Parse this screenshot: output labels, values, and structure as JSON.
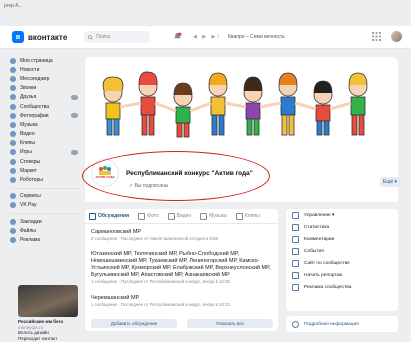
{
  "browser": {
    "tab_title": "prep A..."
  },
  "header": {
    "logo_text": "вконтакте",
    "search_placeholder": "Поиск",
    "player_controls": "◀ ▶ ▶|",
    "track": "Квапро – Семи вечность"
  },
  "sidebar": {
    "items": [
      "Моя страница",
      "Новости",
      "Мессенджер",
      "Звонки",
      "Друзья",
      "Сообщества",
      "Фотографии",
      "Музыка",
      "Видео",
      "Клипы",
      "Игры",
      "Стикеры",
      "Маркет",
      "Роботоры"
    ],
    "items2": [
      "Сервисы",
      "VK Pay"
    ],
    "items3": [
      "Закладки",
      "Файлы",
      "Реклама"
    ],
    "promo_title": "Российские мм бега",
    "promo_sub": "moneyQA.ru",
    "promo_text": "Вплоть дизайн\nПереходит контакт"
  },
  "group": {
    "avatar_label": "АКТИВ ГОДА",
    "title": "Республиканский конкурс \"Актив года\"",
    "subscribed": "Вы подписаны",
    "more": "Ещё ▾"
  },
  "tabs": [
    "Обсуждения",
    "Фото",
    "Видео",
    "Музыка",
    "Клипы"
  ],
  "topics": [
    {
      "title": "Сарманоовский МР",
      "meta": "2 сообщения · Последнее от Наиля Шангалиной сегодня в 8:58"
    },
    {
      "title": "Ютазинский МР, Тюлячинский МР, Рыбно-Слободский МР, Новошешминский МР, Тукаевский МР, Лениногорский МР, Камско-Устьинский МР, Кукморский МР, Елабужский МР, Верхнеуслонский МР, Бугульминский МР, Апастовский МР, Азнакаевский МР",
      "meta": "1 сообщение · Последнее от Республиканский конкурс, вчера в 10:35"
    },
    {
      "title": "Черемшанский МР",
      "meta": "1 сообщение · Последнее от Республиканский конкурс, вчера в 10:23"
    }
  ],
  "buttons": {
    "add": "Добавить обсуждение",
    "show_all": "Показать все"
  },
  "right_panel": {
    "items": [
      "Управление ▾",
      "Статистика",
      "Комментарии",
      "События",
      "Сайт по сообществе",
      "Начать репортаж",
      "Реклама сообщества"
    ],
    "more_info": "Подробная информация"
  },
  "colors": {
    "accent": "#0077ff",
    "link": "#2a5885",
    "highlight": "#d42020"
  }
}
